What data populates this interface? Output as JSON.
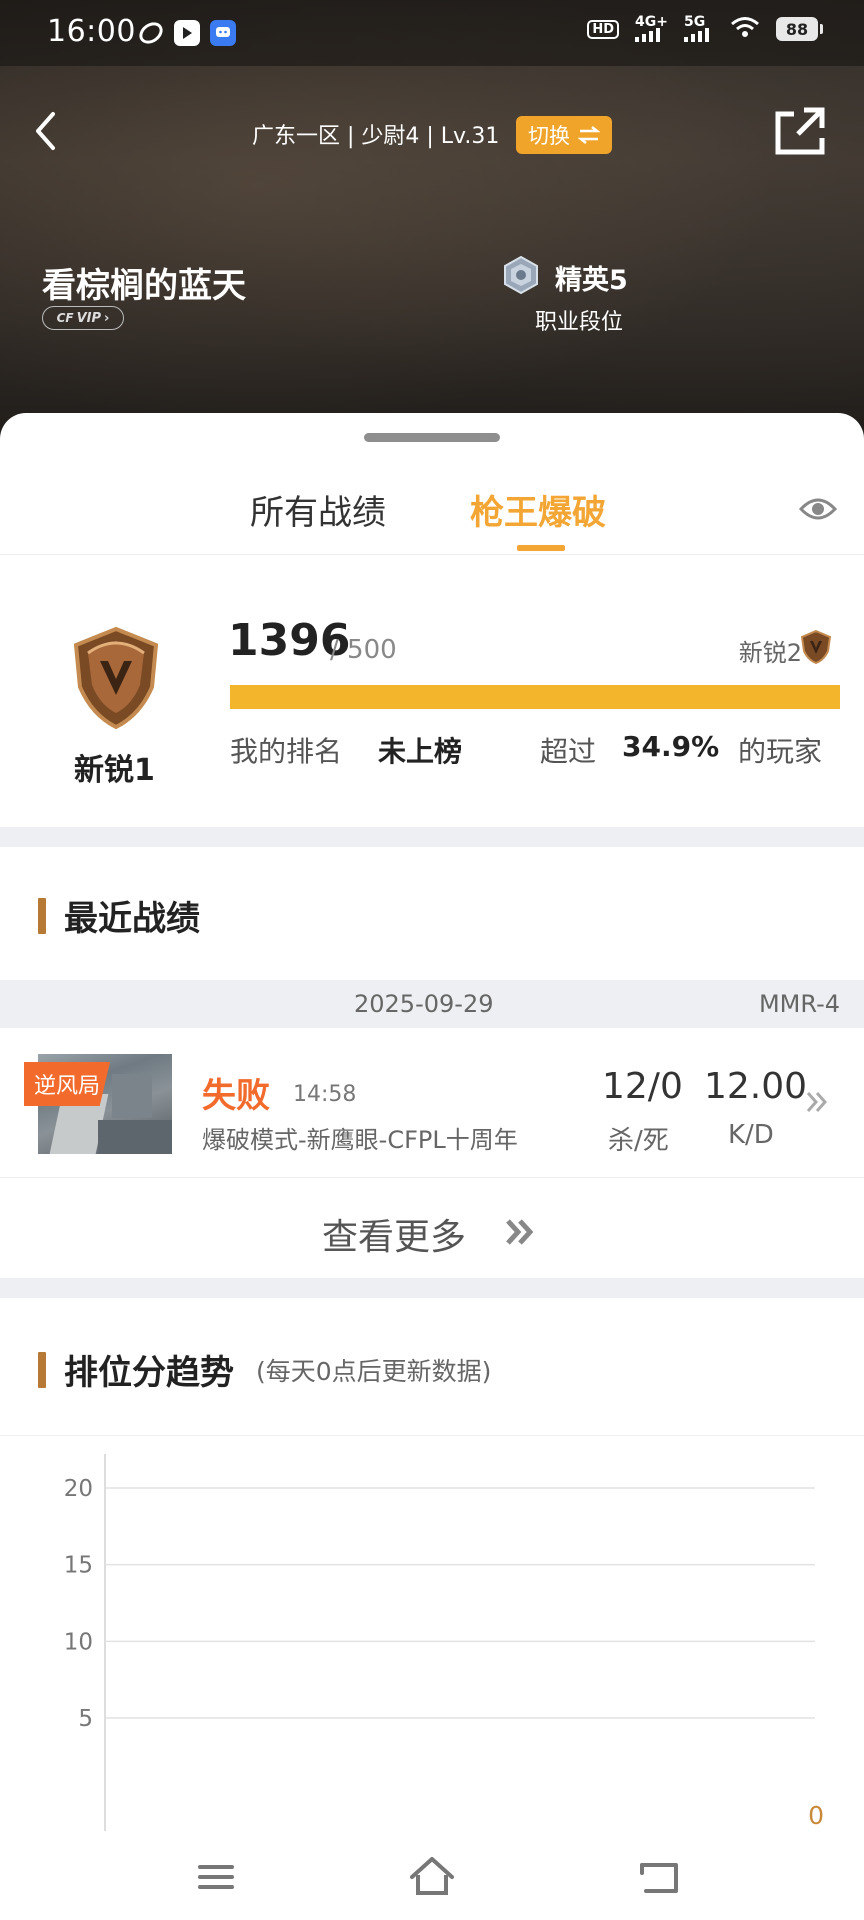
{
  "status_bar": {
    "time": "16:00",
    "network_1": "4G+",
    "network_2": "5G",
    "hd_label": "HD",
    "battery": "88",
    "icons": [
      "sync-app-icon",
      "play-app-icon",
      "chat-app-icon",
      "wifi-icon"
    ]
  },
  "header": {
    "server_info": "广东一区 | 少尉4 | Lv.31",
    "switch_label": "切换",
    "player_name": "看棕榈的蓝天",
    "vip_label": "VIP",
    "career_rank": "精英5",
    "career_rank_sub": "职业段位"
  },
  "tabs": {
    "all": "所有战绩",
    "active": "枪王爆破"
  },
  "rank_card": {
    "current_rank": "新锐1",
    "score": "1396",
    "score_max": "/ 500",
    "next_rank": "新锐2",
    "progress": 1.0,
    "my_rank_label": "我的排名",
    "my_rank_value": "未上榜",
    "exceed_label": "超过",
    "exceed_value": "34.9%",
    "exceed_suffix": "的玩家",
    "accent_color": "#f3b52b"
  },
  "recent": {
    "title": "最近战绩",
    "date": "2025-09-29",
    "mmr": "MMR-4",
    "battle": {
      "tag": "逆风局",
      "result": "失败",
      "time": "14:58",
      "mode": "爆破模式-新鹰眼-CFPL十周年",
      "kills_deaths": "12/0",
      "kills_deaths_label": "杀/死",
      "kd": "12.00",
      "kd_label": "K/D",
      "result_color": "#f26b2d"
    },
    "more_label": "查看更多"
  },
  "trend": {
    "title": "排位分趋势",
    "note": "(每天0点后更新数据)"
  },
  "chart_data": {
    "type": "line",
    "title": "",
    "xlabel": "",
    "ylabel": "",
    "y_ticks": [
      "20",
      "15",
      "10",
      "5"
    ],
    "ylim": [
      3.5,
      22
    ],
    "grid": true,
    "series": [
      {
        "values": [
          0
        ]
      }
    ],
    "data_labels": [
      "0"
    ]
  },
  "bottom_nav": [
    "menu-icon",
    "home-icon",
    "back-icon"
  ]
}
